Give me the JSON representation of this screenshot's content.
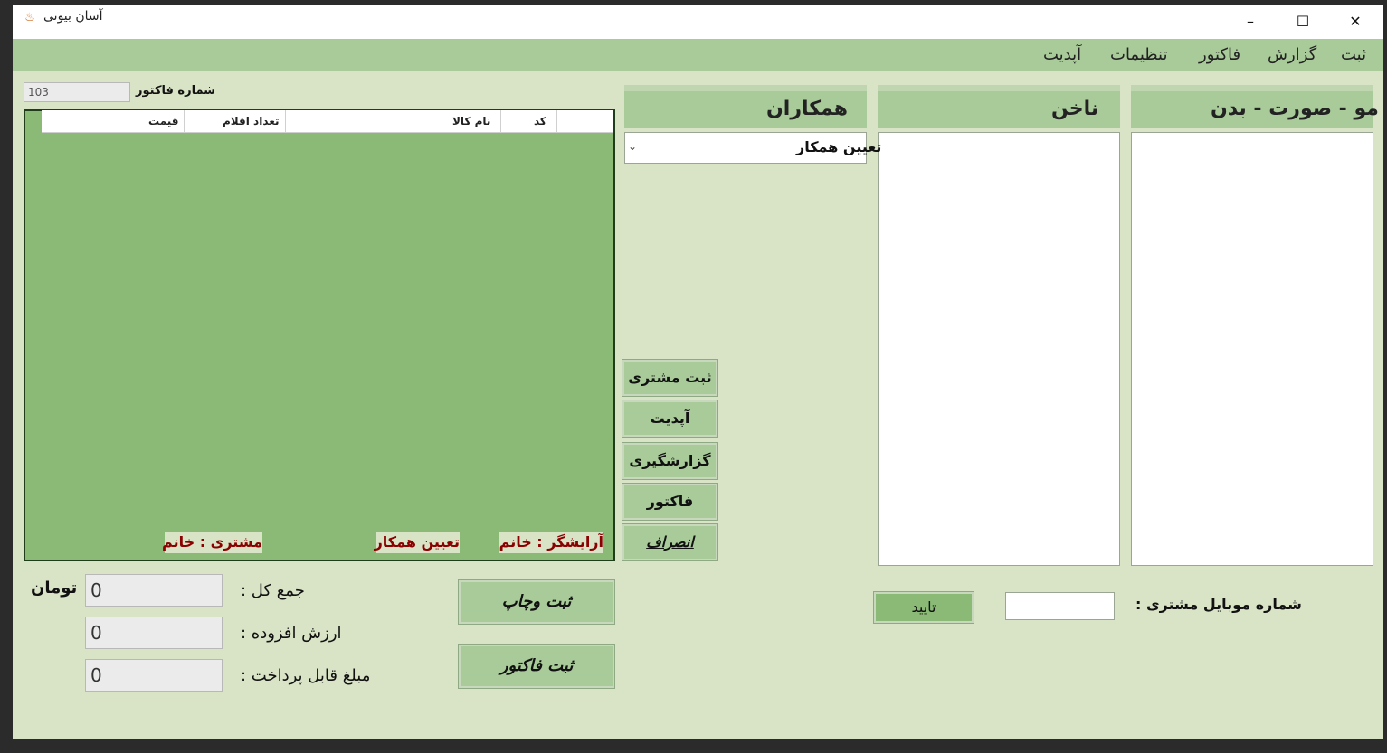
{
  "window": {
    "title": "آسان بیوتی",
    "app_icon": "beauty-app-icon",
    "controls": {
      "minimize": "–",
      "maximize": "☐",
      "close": "✕"
    }
  },
  "menu": {
    "items": [
      "ثبت",
      "گزارش",
      "فاکتور",
      "تنظیمات",
      "آپدیت"
    ]
  },
  "panels": {
    "hair": "مو - صورت - بدن",
    "nail": "ناخن",
    "colleagues": "همکاران"
  },
  "colleague_combo": {
    "value": "تعیین همکار"
  },
  "invoice": {
    "number_label": "شماره فاکتور",
    "number_value": "103"
  },
  "grid": {
    "columns": [
      "کد",
      "نام کالا",
      "تعداد اقلام",
      "قیمت"
    ],
    "rows": []
  },
  "tags": {
    "stylist": "آرایشگر : خانم",
    "assign": "تعیین همکار",
    "customer": "مشتری : خانم"
  },
  "side_buttons": {
    "register_customer": "ثبت مشتری",
    "update": "آپدیت",
    "reports": "گزارشگیری",
    "invoice": "فاکتور",
    "cancel": "انصراف"
  },
  "actions": {
    "save_print": "ثبت وچاپ",
    "save_invoice": "ثبت فاکتور"
  },
  "totals": {
    "currency": "تومان",
    "total_label": "جمع کل :",
    "total_value": "0",
    "vat_label": "ارزش افزوده :",
    "vat_value": "0",
    "payable_label": "مبلغ قابل پرداخت :",
    "payable_value": "0"
  },
  "mobile": {
    "label": "شماره موبایل مشتری :",
    "value": "",
    "confirm": "تایید"
  },
  "colors": {
    "background": "#d9e4c7",
    "accent": "#a9cb9a",
    "grid": "#8aba75",
    "tag_text": "#8b0000"
  }
}
